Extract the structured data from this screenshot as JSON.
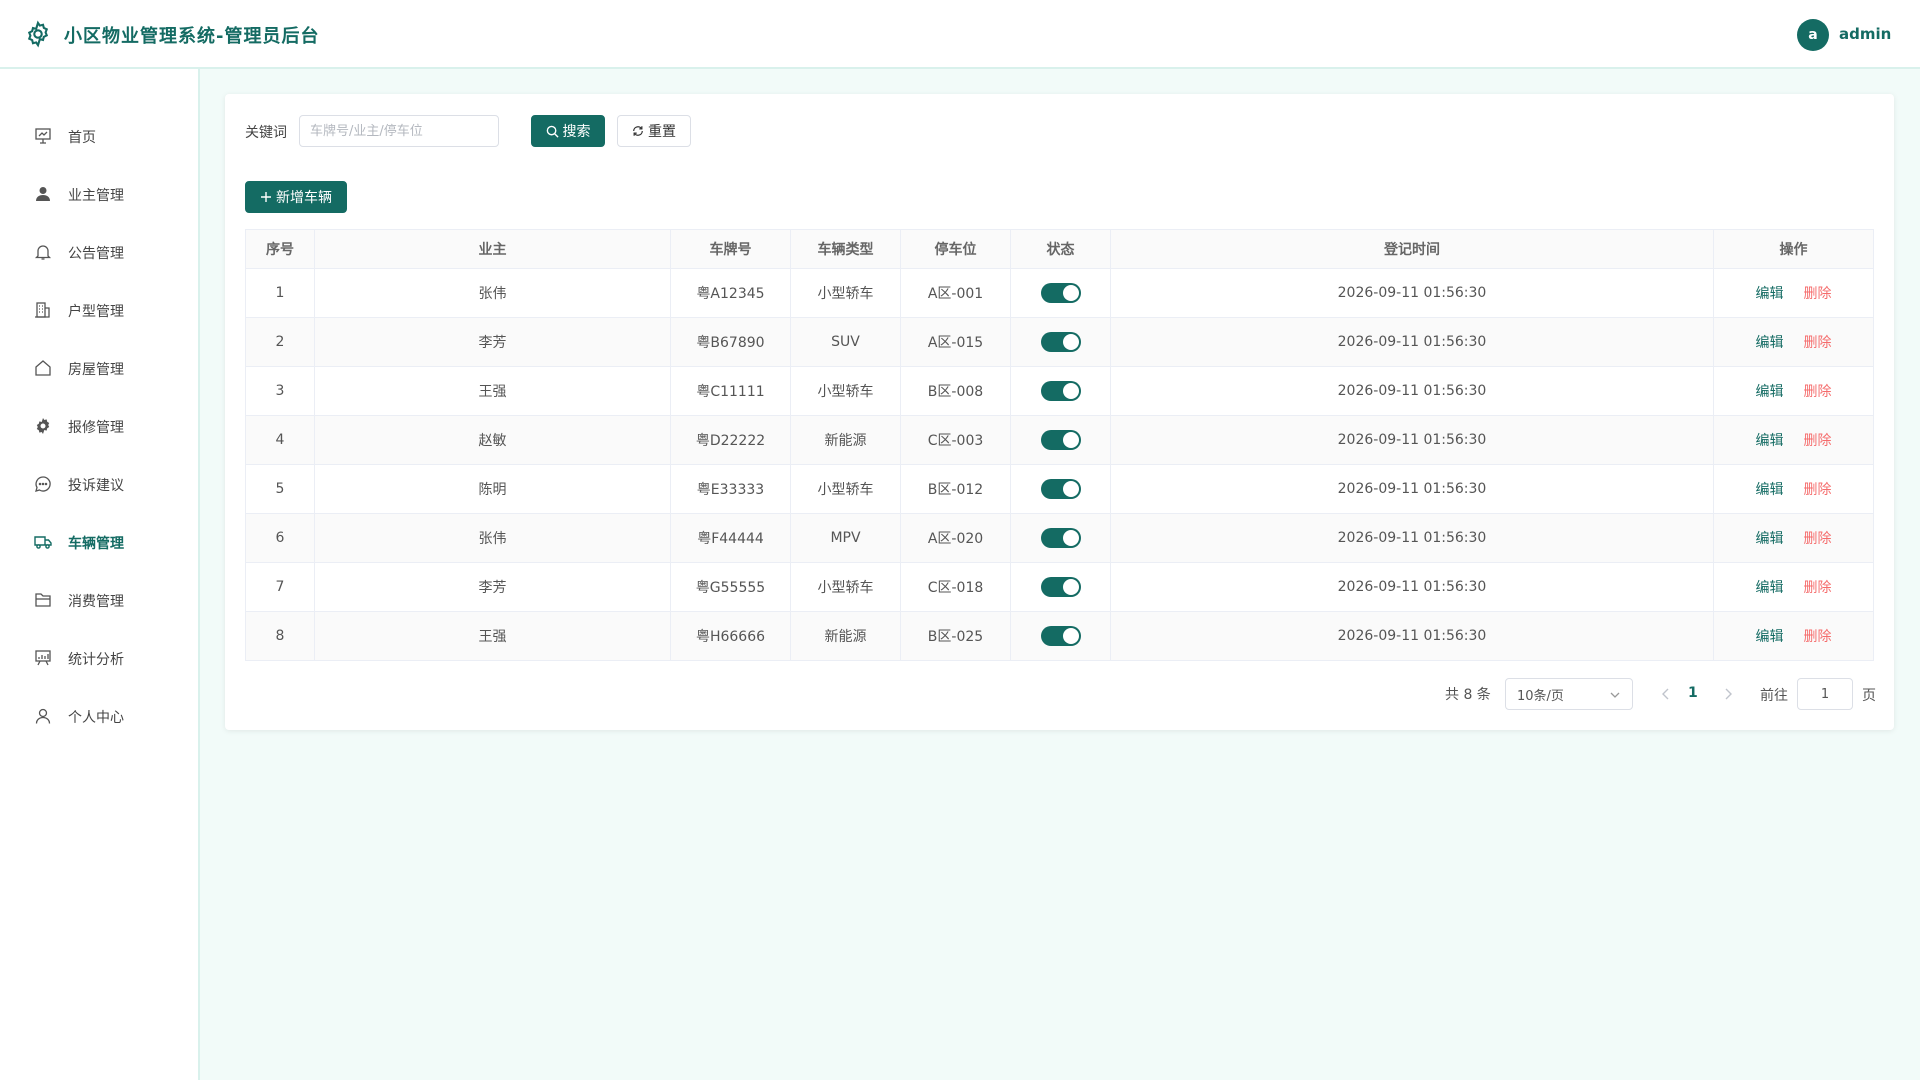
{
  "header": {
    "title": "小区物业管理系统-管理员后台",
    "avatar_letter": "a",
    "username": "admin"
  },
  "colors": {
    "primary": "#146b63",
    "danger": "#f56c6c",
    "background": "#f2fbf9"
  },
  "sidebar": {
    "items": [
      {
        "label": "首页",
        "icon": "dashboard-icon",
        "active": false
      },
      {
        "label": "业主管理",
        "icon": "user-icon",
        "active": false
      },
      {
        "label": "公告管理",
        "icon": "bell-icon",
        "active": false
      },
      {
        "label": "户型管理",
        "icon": "building-icon",
        "active": false
      },
      {
        "label": "房屋管理",
        "icon": "house-icon",
        "active": false
      },
      {
        "label": "报修管理",
        "icon": "gear-icon",
        "active": false
      },
      {
        "label": "投诉建议",
        "icon": "chat-icon",
        "active": false
      },
      {
        "label": "车辆管理",
        "icon": "truck-icon",
        "active": true
      },
      {
        "label": "消费管理",
        "icon": "folder-icon",
        "active": false
      },
      {
        "label": "统计分析",
        "icon": "chart-board-icon",
        "active": false
      },
      {
        "label": "个人中心",
        "icon": "person-icon",
        "active": false
      }
    ]
  },
  "search": {
    "keyword_label": "关键词",
    "placeholder": "车牌号/业主/停车位",
    "value": "",
    "search_button": "搜索",
    "reset_button": "重置"
  },
  "actions": {
    "add_button": "新增车辆"
  },
  "table": {
    "columns": [
      "序号",
      "业主",
      "车牌号",
      "车辆类型",
      "停车位",
      "状态",
      "登记时间",
      "操作"
    ],
    "rows": [
      {
        "index": "1",
        "owner": "张伟",
        "plate": "粤A12345",
        "type": "小型轿车",
        "space": "A区-001",
        "status": true,
        "time": "2026-09-11 01:56:30"
      },
      {
        "index": "2",
        "owner": "李芳",
        "plate": "粤B67890",
        "type": "SUV",
        "space": "A区-015",
        "status": true,
        "time": "2026-09-11 01:56:30"
      },
      {
        "index": "3",
        "owner": "王强",
        "plate": "粤C11111",
        "type": "小型轿车",
        "space": "B区-008",
        "status": true,
        "time": "2026-09-11 01:56:30"
      },
      {
        "index": "4",
        "owner": "赵敏",
        "plate": "粤D22222",
        "type": "新能源",
        "space": "C区-003",
        "status": true,
        "time": "2026-09-11 01:56:30"
      },
      {
        "index": "5",
        "owner": "陈明",
        "plate": "粤E33333",
        "type": "小型轿车",
        "space": "B区-012",
        "status": true,
        "time": "2026-09-11 01:56:30"
      },
      {
        "index": "6",
        "owner": "张伟",
        "plate": "粤F44444",
        "type": "MPV",
        "space": "A区-020",
        "status": true,
        "time": "2026-09-11 01:56:30"
      },
      {
        "index": "7",
        "owner": "李芳",
        "plate": "粤G55555",
        "type": "小型轿车",
        "space": "C区-018",
        "status": true,
        "time": "2026-09-11 01:56:30"
      },
      {
        "index": "8",
        "owner": "王强",
        "plate": "粤H66666",
        "type": "新能源",
        "space": "B区-025",
        "status": true,
        "time": "2026-09-11 01:56:30"
      }
    ],
    "edit_label": "编辑",
    "delete_label": "删除"
  },
  "pagination": {
    "total_text": "共 8 条",
    "page_size": "10条/页",
    "current_page": "1",
    "goto_label": "前往",
    "goto_value": "1",
    "page_suffix": "页"
  }
}
